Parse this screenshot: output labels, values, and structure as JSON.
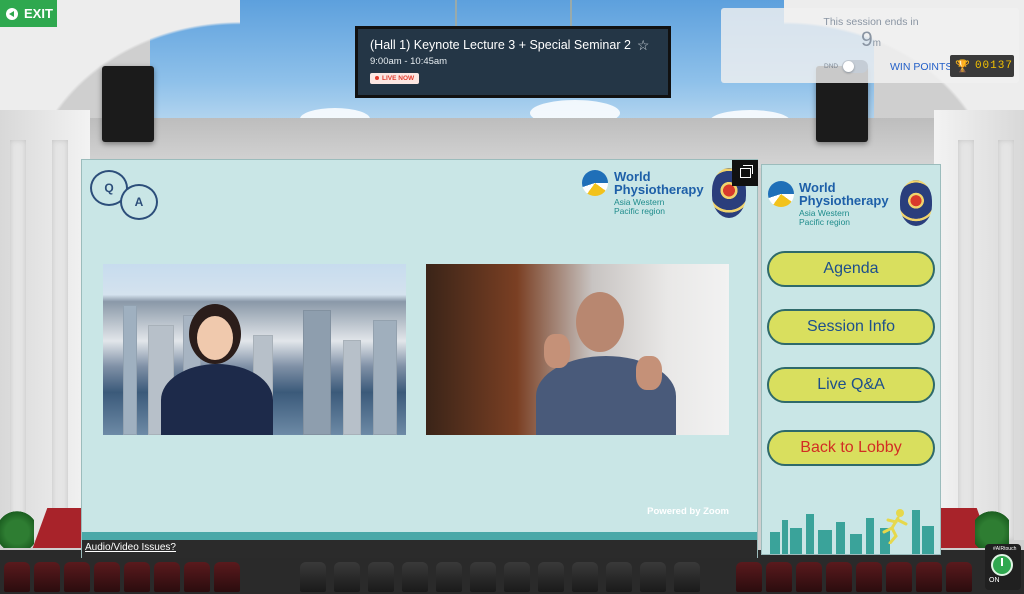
{
  "exit": {
    "label": "EXIT"
  },
  "banner": {
    "title": "(Hall 1) Keynote Lecture 3 + Special Seminar 2",
    "time": "9:00am - 10:45am",
    "live": "LIVE NOW"
  },
  "session": {
    "ends_label": "This session ends in",
    "ends_value": "9",
    "ends_unit": "m",
    "dnd_label": "DND",
    "win_label": "WIN POINTS",
    "points": "00137"
  },
  "screen": {
    "qa_q": "Q",
    "qa_a": "A",
    "logo_line1": "World",
    "logo_line2": "Physiotherapy",
    "logo_sub1": "Asia Western",
    "logo_sub2": "Pacific region",
    "powered": "Powered by Zoom",
    "av_issues": "Audio/Video Issues?"
  },
  "menu": {
    "logo_line1": "World",
    "logo_line2": "Physiotherapy",
    "logo_sub1": "Asia Western",
    "logo_sub2": "Pacific region",
    "items": [
      {
        "label": "Agenda"
      },
      {
        "label": "Session Info"
      },
      {
        "label": "Live Q&A"
      },
      {
        "label": "Back to Lobby"
      }
    ]
  },
  "power": {
    "tag": "#AIRtouch",
    "label": "ON"
  },
  "colors": {
    "exit_green": "#2fa84f",
    "menu_button": "#d9df5e",
    "menu_text": "#1d4f8c",
    "lobby_text": "#d22d24",
    "screen_bg": "#c9e6e6",
    "points_gold": "#f4c200"
  }
}
